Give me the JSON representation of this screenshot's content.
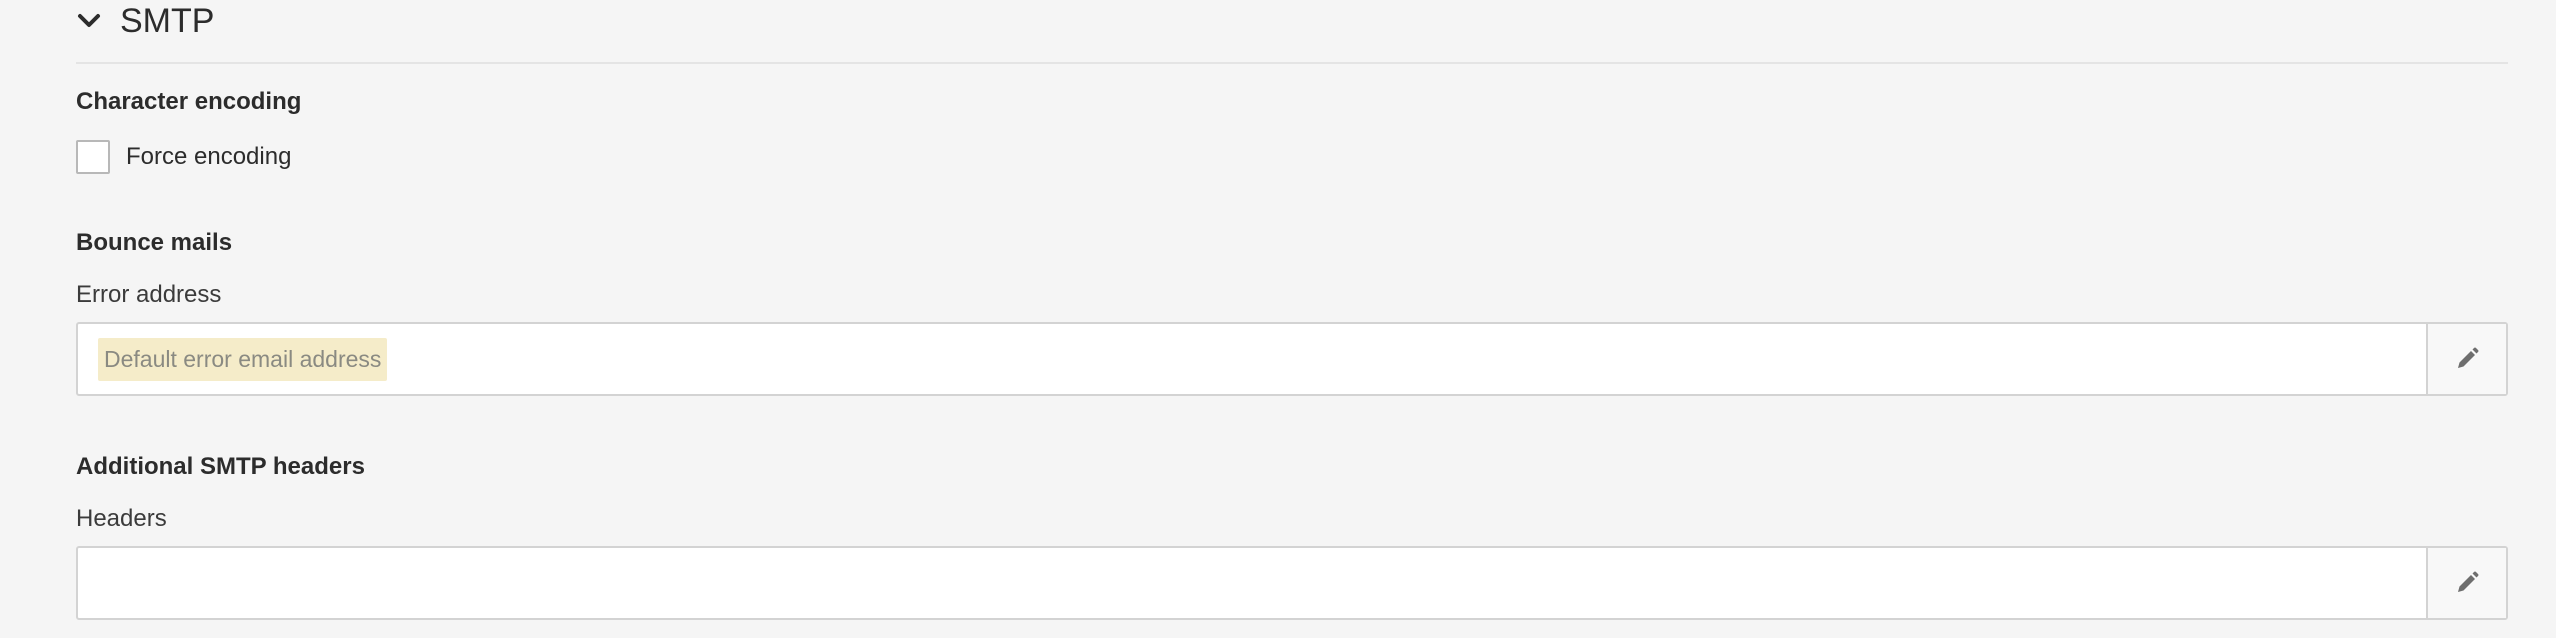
{
  "section": {
    "title": "SMTP",
    "expanded": true
  },
  "character_encoding": {
    "heading": "Character encoding",
    "force_encoding": {
      "label": "Force encoding",
      "checked": false
    }
  },
  "bounce_mails": {
    "heading": "Bounce mails",
    "error_address": {
      "label": "Error address",
      "value": "Default error email address"
    }
  },
  "additional_headers": {
    "heading": "Additional SMTP headers",
    "headers": {
      "label": "Headers",
      "value": ""
    }
  },
  "icons": {
    "section_toggle": "chevron-down-icon",
    "edit": "pencil-icon"
  },
  "colors": {
    "background": "#f5f5f5",
    "chip_background": "#f5ecc9",
    "chip_text": "#8a8a82",
    "border": "#d3d3d3"
  }
}
